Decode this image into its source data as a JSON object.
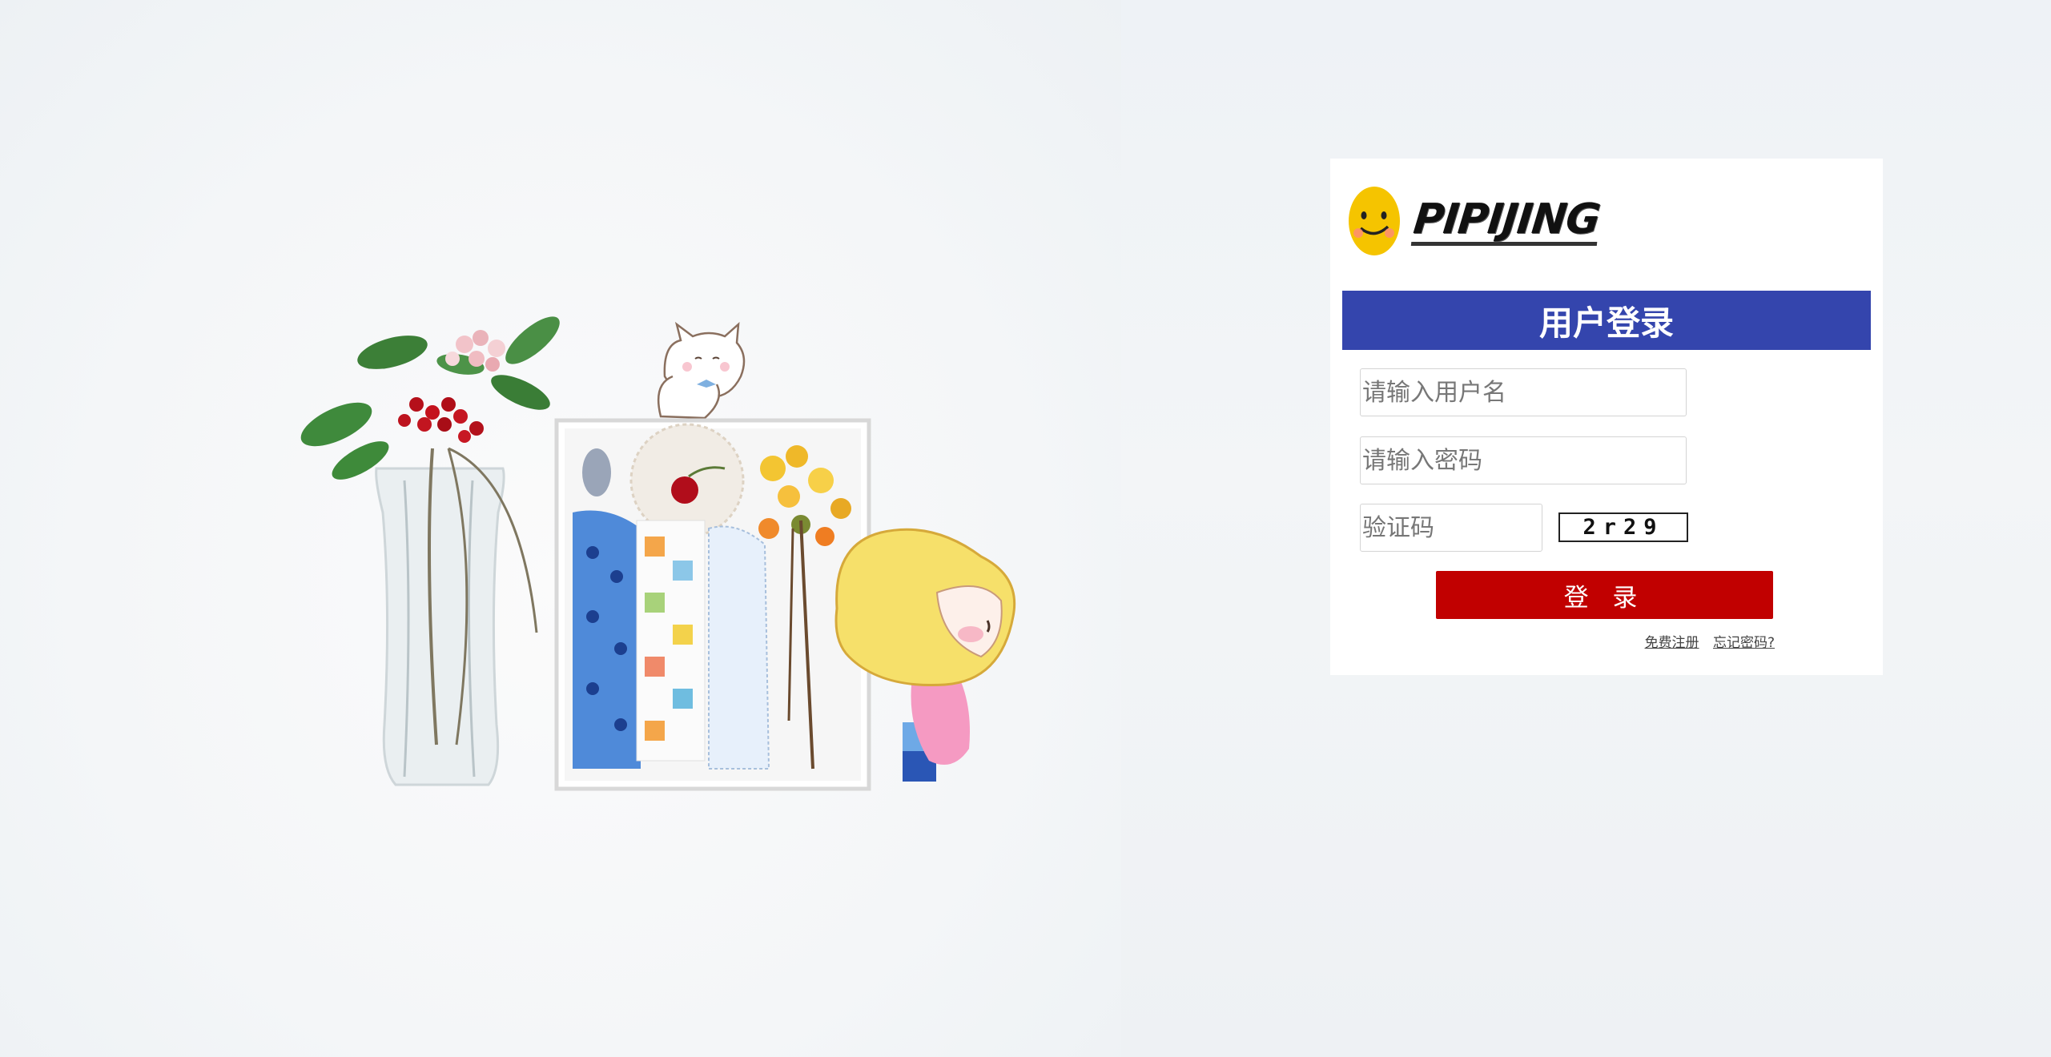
{
  "logo": {
    "text": "PIPIJING",
    "mascot_icon": "smiley-face-icon",
    "mascot_color": "#f5c400"
  },
  "login": {
    "title": "用户登录",
    "title_bar_color": "#3445ad",
    "username_placeholder": "请输入用户名",
    "username_value": "",
    "password_placeholder": "请输入密码",
    "password_value": "",
    "captcha_placeholder": "验证码",
    "captcha_value": "",
    "captcha_code": "2r29",
    "submit_label": "登 录",
    "submit_color": "#c10000",
    "register_link": "免费注册",
    "forgot_link": "忘记密码?"
  }
}
